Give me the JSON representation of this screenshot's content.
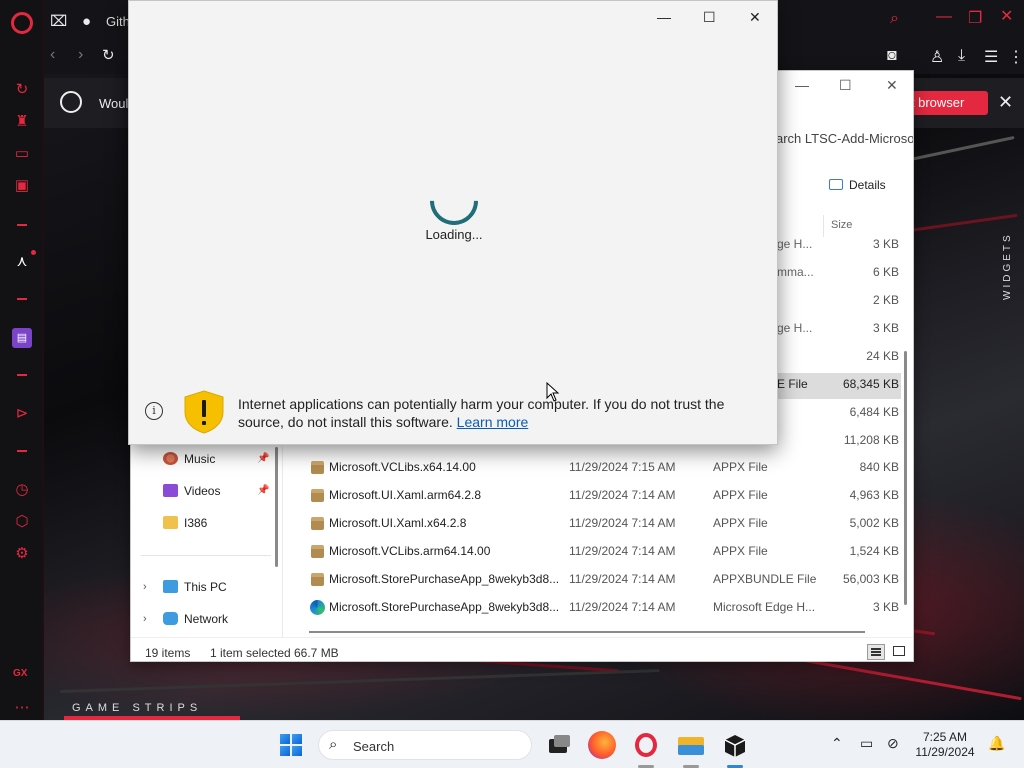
{
  "browser": {
    "tab_title": "Gith",
    "notification_text": "Woul",
    "default_button": "lt browser",
    "widgets_label": "WIDGETS",
    "game_strips_label": "GAME STRIPS",
    "gx_label": "GX",
    "accent": "#e3283f"
  },
  "explorer": {
    "search_text": "arch LTSC-Add-Microso",
    "details_label": "Details",
    "size_header": "Size",
    "preview_rows": [
      {
        "type": "ge H...",
        "size": "3 KB"
      },
      {
        "type": "mma...",
        "size": "6 KB"
      },
      {
        "type": "",
        "size": "2 KB"
      },
      {
        "type": "ge H...",
        "size": "3 KB"
      },
      {
        "type": "",
        "size": "24 KB"
      },
      {
        "type": "E File",
        "size": "68,345 KB"
      },
      {
        "type": "",
        "size": "6,484 KB"
      },
      {
        "type": "",
        "size": "11,208 KB"
      }
    ],
    "nav": {
      "music": "Music",
      "videos": "Videos",
      "i386": "I386",
      "this_pc": "This PC",
      "network": "Network"
    },
    "files": [
      {
        "name": "Microsoft.VCLibs.x64.14.00",
        "date": "11/29/2024 7:15 AM",
        "type": "APPX File",
        "size": "840 KB",
        "icon": "package-icon"
      },
      {
        "name": "Microsoft.UI.Xaml.arm64.2.8",
        "date": "11/29/2024 7:14 AM",
        "type": "APPX File",
        "size": "4,963 KB",
        "icon": "package-icon"
      },
      {
        "name": "Microsoft.UI.Xaml.x64.2.8",
        "date": "11/29/2024 7:14 AM",
        "type": "APPX File",
        "size": "5,002 KB",
        "icon": "package-icon"
      },
      {
        "name": "Microsoft.VCLibs.arm64.14.00",
        "date": "11/29/2024 7:14 AM",
        "type": "APPX File",
        "size": "1,524 KB",
        "icon": "package-icon"
      },
      {
        "name": "Microsoft.StorePurchaseApp_8wekyb3d8...",
        "date": "11/29/2024 7:14 AM",
        "type": "APPXBUNDLE File",
        "size": "56,003 KB",
        "icon": "package-icon"
      },
      {
        "name": "Microsoft.StorePurchaseApp_8wekyb3d8...",
        "date": "11/29/2024 7:14 AM",
        "type": "Microsoft Edge H...",
        "size": "3 KB",
        "icon": "edge-icon"
      }
    ],
    "status": {
      "count": "19 items",
      "selected": "1 item selected",
      "selected_size": "66.7 MB"
    }
  },
  "installer": {
    "loading_text": "Loading...",
    "warning_text": "Internet applications can potentially harm your computer. If you do not trust the source, do not install this software.",
    "learn_more": "Learn more"
  },
  "taskbar": {
    "search_placeholder": "Search",
    "time": "7:25 AM",
    "date": "11/29/2024"
  }
}
